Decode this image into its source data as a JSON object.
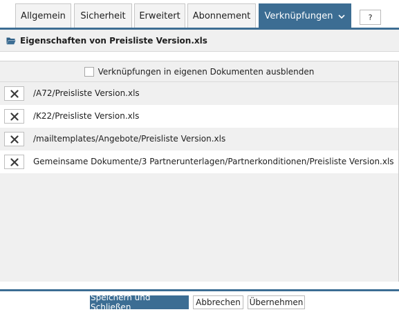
{
  "tabs": [
    {
      "label": "Allgemein",
      "active": false
    },
    {
      "label": "Sicherheit",
      "active": false
    },
    {
      "label": "Erweitert",
      "active": false
    },
    {
      "label": "Abonnement",
      "active": false
    },
    {
      "label": "Verknüpfungen",
      "active": true,
      "icon": "chevron-down-icon"
    }
  ],
  "help_label": "?",
  "header": {
    "icon": "folder-open-icon",
    "title": "Eigenschaften von Preisliste Version.xls"
  },
  "hide_option": {
    "label": "Verknüpfungen in eigenen Dokumenten ausblenden",
    "checked": false
  },
  "links": [
    {
      "path": "/A72/Preisliste Version.xls"
    },
    {
      "path": "/K22/Preisliste Version.xls"
    },
    {
      "path": "/mailtemplates/Angebote/Preisliste Version.xls"
    },
    {
      "path": "Gemeinsame Dokumente/3 Partnerunterlagen/Partnerkonditionen/Preisliste Version.xls"
    }
  ],
  "footer": {
    "save_close_label": "Speichern und Schließen",
    "cancel_label": "Abbrechen",
    "apply_label": "Übernehmen"
  },
  "colors": {
    "accent": "#3c6d93",
    "panel_bg": "#f0f0f0",
    "row_alt_bg": "#ffffff"
  }
}
